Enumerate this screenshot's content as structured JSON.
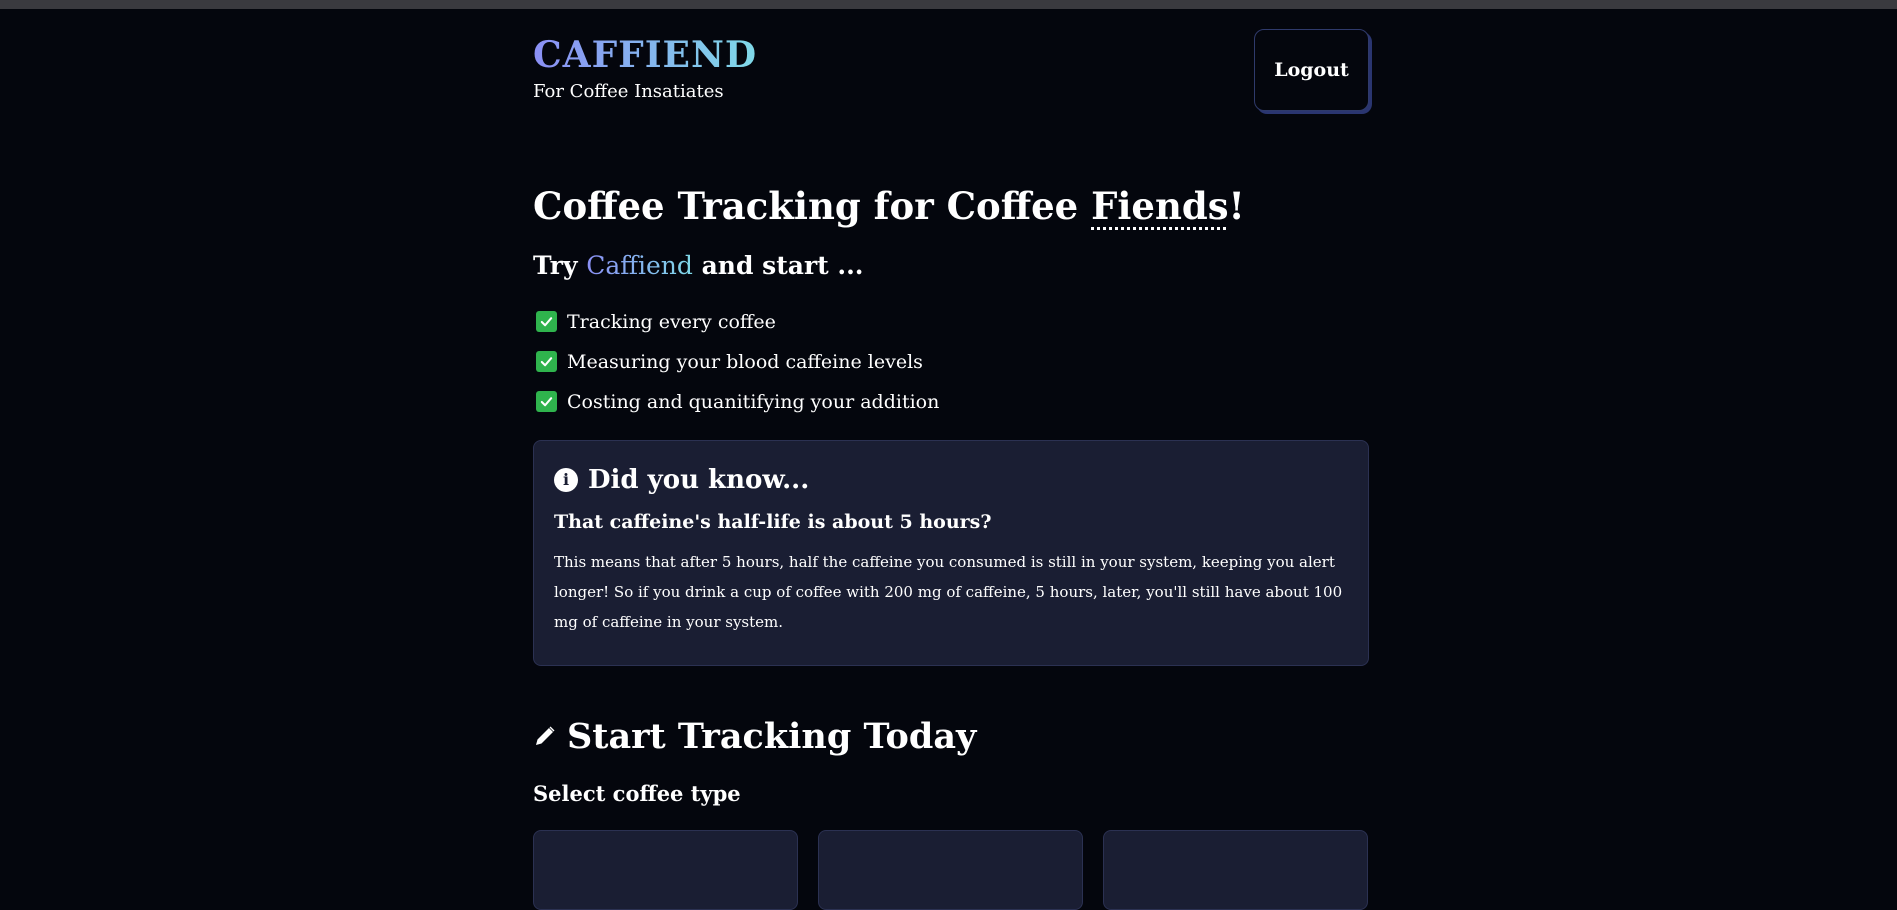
{
  "header": {
    "brand": "CAFFIEND",
    "tagline": "For Coffee Insatiates",
    "logout_label": "Logout"
  },
  "hero": {
    "title_prefix": "Coffee Tracking for Coffee ",
    "title_emphasis": "Fiends",
    "title_suffix": "!",
    "subtitle_prefix": "Try ",
    "subtitle_brand": "Caffiend",
    "subtitle_suffix": " and start ...",
    "benefits": [
      "Tracking every coffee",
      "Measuring your blood caffeine levels",
      "Costing and quanitifying your addition"
    ]
  },
  "info": {
    "title": "Did you know...",
    "question": "That caffeine's half-life is about 5 hours?",
    "body": "This means that after 5 hours, half the caffeine you consumed is still in your system, keeping you alert longer! So if you drink a cup of coffee with 200 mg of caffeine, 5 hours, later, you'll still have about 100 mg of caffeine in your system."
  },
  "tracking": {
    "title": "Start Tracking Today",
    "select_label": "Select coffee type"
  },
  "icons": {
    "check": "check-square-icon",
    "info": "info-circle-icon",
    "pencil": "pencil-icon"
  },
  "colors": {
    "background": "#04060d",
    "card": "#1a1e33",
    "gradient_start": "#8b8ff5",
    "gradient_end": "#7fd9e8",
    "check": "#2fb34d"
  }
}
